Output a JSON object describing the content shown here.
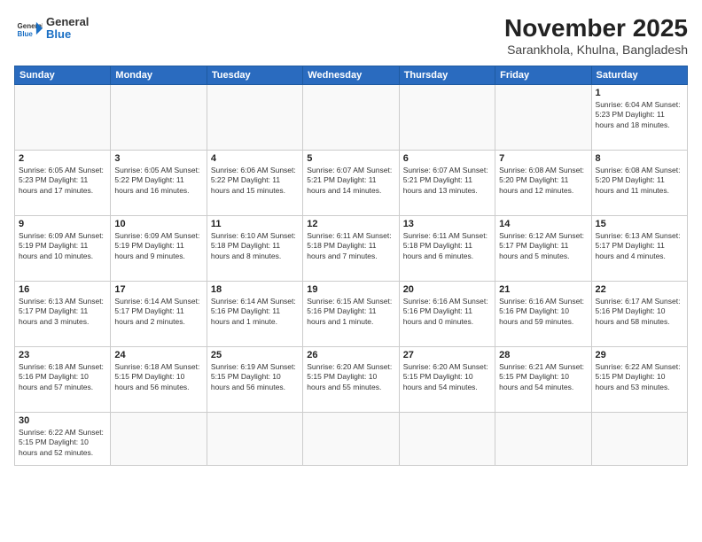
{
  "header": {
    "logo_general": "General",
    "logo_blue": "Blue",
    "month_year": "November 2025",
    "location": "Sarankhola, Khulna, Bangladesh"
  },
  "weekdays": [
    "Sunday",
    "Monday",
    "Tuesday",
    "Wednesday",
    "Thursday",
    "Friday",
    "Saturday"
  ],
  "weeks": [
    [
      {
        "day": "",
        "info": ""
      },
      {
        "day": "",
        "info": ""
      },
      {
        "day": "",
        "info": ""
      },
      {
        "day": "",
        "info": ""
      },
      {
        "day": "",
        "info": ""
      },
      {
        "day": "",
        "info": ""
      },
      {
        "day": "1",
        "info": "Sunrise: 6:04 AM\nSunset: 5:23 PM\nDaylight: 11 hours and 18 minutes."
      }
    ],
    [
      {
        "day": "2",
        "info": "Sunrise: 6:05 AM\nSunset: 5:23 PM\nDaylight: 11 hours and 17 minutes."
      },
      {
        "day": "3",
        "info": "Sunrise: 6:05 AM\nSunset: 5:22 PM\nDaylight: 11 hours and 16 minutes."
      },
      {
        "day": "4",
        "info": "Sunrise: 6:06 AM\nSunset: 5:22 PM\nDaylight: 11 hours and 15 minutes."
      },
      {
        "day": "5",
        "info": "Sunrise: 6:07 AM\nSunset: 5:21 PM\nDaylight: 11 hours and 14 minutes."
      },
      {
        "day": "6",
        "info": "Sunrise: 6:07 AM\nSunset: 5:21 PM\nDaylight: 11 hours and 13 minutes."
      },
      {
        "day": "7",
        "info": "Sunrise: 6:08 AM\nSunset: 5:20 PM\nDaylight: 11 hours and 12 minutes."
      },
      {
        "day": "8",
        "info": "Sunrise: 6:08 AM\nSunset: 5:20 PM\nDaylight: 11 hours and 11 minutes."
      }
    ],
    [
      {
        "day": "9",
        "info": "Sunrise: 6:09 AM\nSunset: 5:19 PM\nDaylight: 11 hours and 10 minutes."
      },
      {
        "day": "10",
        "info": "Sunrise: 6:09 AM\nSunset: 5:19 PM\nDaylight: 11 hours and 9 minutes."
      },
      {
        "day": "11",
        "info": "Sunrise: 6:10 AM\nSunset: 5:18 PM\nDaylight: 11 hours and 8 minutes."
      },
      {
        "day": "12",
        "info": "Sunrise: 6:11 AM\nSunset: 5:18 PM\nDaylight: 11 hours and 7 minutes."
      },
      {
        "day": "13",
        "info": "Sunrise: 6:11 AM\nSunset: 5:18 PM\nDaylight: 11 hours and 6 minutes."
      },
      {
        "day": "14",
        "info": "Sunrise: 6:12 AM\nSunset: 5:17 PM\nDaylight: 11 hours and 5 minutes."
      },
      {
        "day": "15",
        "info": "Sunrise: 6:13 AM\nSunset: 5:17 PM\nDaylight: 11 hours and 4 minutes."
      }
    ],
    [
      {
        "day": "16",
        "info": "Sunrise: 6:13 AM\nSunset: 5:17 PM\nDaylight: 11 hours and 3 minutes."
      },
      {
        "day": "17",
        "info": "Sunrise: 6:14 AM\nSunset: 5:17 PM\nDaylight: 11 hours and 2 minutes."
      },
      {
        "day": "18",
        "info": "Sunrise: 6:14 AM\nSunset: 5:16 PM\nDaylight: 11 hours and 1 minute."
      },
      {
        "day": "19",
        "info": "Sunrise: 6:15 AM\nSunset: 5:16 PM\nDaylight: 11 hours and 1 minute."
      },
      {
        "day": "20",
        "info": "Sunrise: 6:16 AM\nSunset: 5:16 PM\nDaylight: 11 hours and 0 minutes."
      },
      {
        "day": "21",
        "info": "Sunrise: 6:16 AM\nSunset: 5:16 PM\nDaylight: 10 hours and 59 minutes."
      },
      {
        "day": "22",
        "info": "Sunrise: 6:17 AM\nSunset: 5:16 PM\nDaylight: 10 hours and 58 minutes."
      }
    ],
    [
      {
        "day": "23",
        "info": "Sunrise: 6:18 AM\nSunset: 5:16 PM\nDaylight: 10 hours and 57 minutes."
      },
      {
        "day": "24",
        "info": "Sunrise: 6:18 AM\nSunset: 5:15 PM\nDaylight: 10 hours and 56 minutes."
      },
      {
        "day": "25",
        "info": "Sunrise: 6:19 AM\nSunset: 5:15 PM\nDaylight: 10 hours and 56 minutes."
      },
      {
        "day": "26",
        "info": "Sunrise: 6:20 AM\nSunset: 5:15 PM\nDaylight: 10 hours and 55 minutes."
      },
      {
        "day": "27",
        "info": "Sunrise: 6:20 AM\nSunset: 5:15 PM\nDaylight: 10 hours and 54 minutes."
      },
      {
        "day": "28",
        "info": "Sunrise: 6:21 AM\nSunset: 5:15 PM\nDaylight: 10 hours and 54 minutes."
      },
      {
        "day": "29",
        "info": "Sunrise: 6:22 AM\nSunset: 5:15 PM\nDaylight: 10 hours and 53 minutes."
      }
    ],
    [
      {
        "day": "30",
        "info": "Sunrise: 6:22 AM\nSunset: 5:15 PM\nDaylight: 10 hours and 52 minutes."
      },
      {
        "day": "",
        "info": ""
      },
      {
        "day": "",
        "info": ""
      },
      {
        "day": "",
        "info": ""
      },
      {
        "day": "",
        "info": ""
      },
      {
        "day": "",
        "info": ""
      },
      {
        "day": "",
        "info": ""
      }
    ]
  ]
}
